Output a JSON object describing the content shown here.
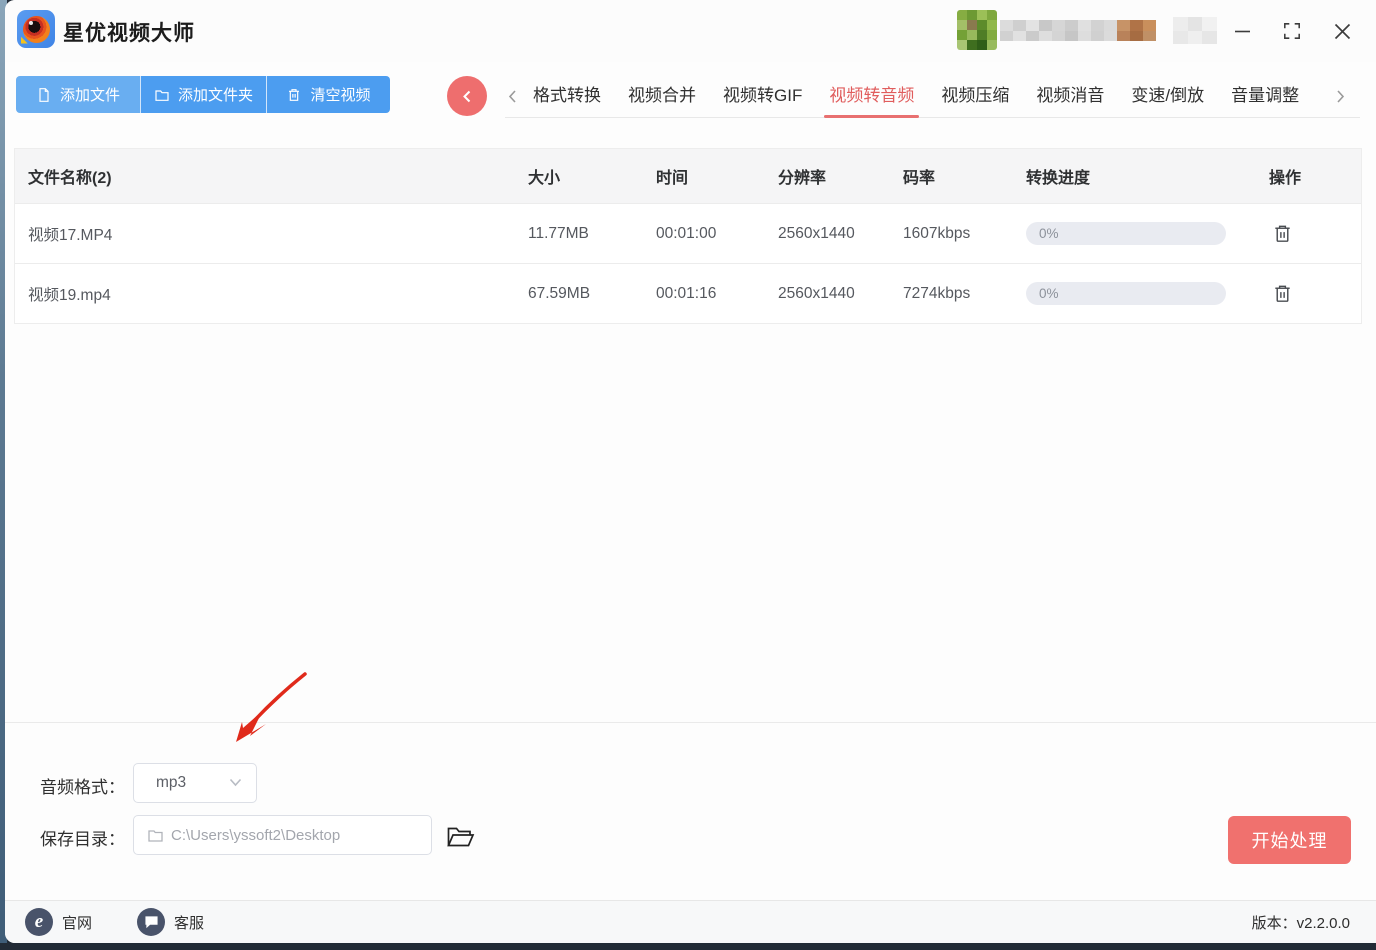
{
  "window": {
    "title": "星优视频大师",
    "controls": [
      "minimize-icon",
      "maximize-icon",
      "close-icon"
    ]
  },
  "toolbar": {
    "buttons": [
      {
        "label": "添加文件",
        "icon": "file-icon"
      },
      {
        "label": "添加文件夹",
        "icon": "folder-icon"
      },
      {
        "label": "清空视频",
        "icon": "trash-icon"
      }
    ]
  },
  "tabs": {
    "items": [
      {
        "label": "格式转换",
        "active": false
      },
      {
        "label": "视频合并",
        "active": false
      },
      {
        "label": "视频转GIF",
        "active": false
      },
      {
        "label": "视频转音频",
        "active": true
      },
      {
        "label": "视频压缩",
        "active": false
      },
      {
        "label": "视频消音",
        "active": false
      },
      {
        "label": "变速/倒放",
        "active": false
      },
      {
        "label": "音量调整",
        "active": false
      }
    ]
  },
  "table": {
    "headers": [
      "文件名称(2)",
      "大小",
      "时间",
      "分辨率",
      "码率",
      "转换进度",
      "操作"
    ],
    "rows": [
      {
        "name": "视频17.MP4",
        "size": "11.77MB",
        "duration": "00:01:00",
        "resolution": "2560x1440",
        "bitrate": "1607kbps",
        "progress": "0%"
      },
      {
        "name": "视频19.mp4",
        "size": "67.59MB",
        "duration": "00:01:16",
        "resolution": "2560x1440",
        "bitrate": "7274kbps",
        "progress": "0%"
      }
    ]
  },
  "settings": {
    "audio_format_label": "音频格式：",
    "audio_format_value": "mp3",
    "save_dir_label": "保存目录：",
    "save_dir_value": "C:\\Users\\yssoft2\\Desktop",
    "start_button": "开始处理"
  },
  "footer": {
    "website": "官网",
    "support": "客服",
    "version": "版本：v2.2.0.0"
  },
  "colors": {
    "accent_blue": "#4c9df0",
    "accent_red": "#ee6e6e",
    "active_tab_red": "#e05d5d",
    "start_button_red": "#f0716e",
    "progress_track": "#e9ebf1"
  }
}
